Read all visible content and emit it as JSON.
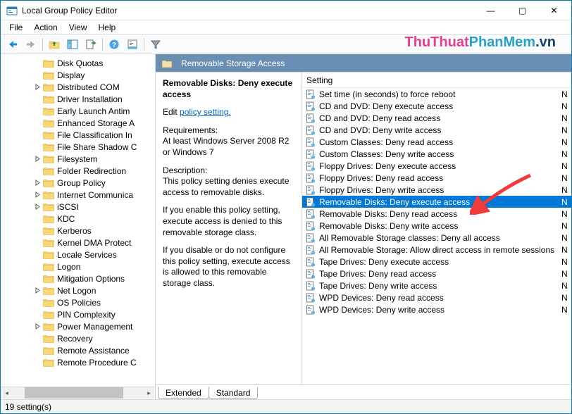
{
  "window": {
    "title": "Local Group Policy Editor",
    "minimize": "—",
    "maximize": "▢",
    "close": "✕"
  },
  "menubar": {
    "items": [
      "File",
      "Action",
      "View",
      "Help"
    ]
  },
  "tree": {
    "items": [
      {
        "label": "Disk Quotas",
        "expandable": false
      },
      {
        "label": "Display",
        "expandable": false
      },
      {
        "label": "Distributed COM",
        "expandable": true
      },
      {
        "label": "Driver Installation",
        "expandable": false
      },
      {
        "label": "Early Launch Antim",
        "expandable": false
      },
      {
        "label": "Enhanced Storage A",
        "expandable": false
      },
      {
        "label": "File Classification In",
        "expandable": false
      },
      {
        "label": "File Share Shadow C",
        "expandable": false
      },
      {
        "label": "Filesystem",
        "expandable": true
      },
      {
        "label": "Folder Redirection",
        "expandable": false
      },
      {
        "label": "Group Policy",
        "expandable": true
      },
      {
        "label": "Internet Communica",
        "expandable": true
      },
      {
        "label": "iSCSI",
        "expandable": true
      },
      {
        "label": "KDC",
        "expandable": false
      },
      {
        "label": "Kerberos",
        "expandable": false
      },
      {
        "label": "Kernel DMA Protect",
        "expandable": false
      },
      {
        "label": "Locale Services",
        "expandable": false
      },
      {
        "label": "Logon",
        "expandable": false
      },
      {
        "label": "Mitigation Options",
        "expandable": false
      },
      {
        "label": "Net Logon",
        "expandable": true
      },
      {
        "label": "OS Policies",
        "expandable": false
      },
      {
        "label": "PIN Complexity",
        "expandable": false
      },
      {
        "label": "Power Management",
        "expandable": true
      },
      {
        "label": "Recovery",
        "expandable": false
      },
      {
        "label": "Remote Assistance",
        "expandable": false
      },
      {
        "label": "Remote Procedure C",
        "expandable": false
      }
    ]
  },
  "right": {
    "header_title": "Removable Storage Access",
    "selected_title": "Removable Disks: Deny execute access",
    "edit_text": "Edit ",
    "edit_link": "policy setting.",
    "req_label": "Requirements:",
    "req_text": "At least Windows Server 2008 R2 or Windows 7",
    "desc_label": "Description:",
    "desc_text": "This policy setting denies execute access to removable disks.",
    "enable_text": "If you enable this policy setting, execute access is denied to this removable storage class.",
    "disable_text": "If you disable or do not configure this policy setting, execute access is allowed to this removable storage class.",
    "column_setting": "Setting",
    "settings": [
      {
        "label": "Set time (in seconds) to force reboot",
        "state": "N",
        "selected": false
      },
      {
        "label": "CD and DVD: Deny execute access",
        "state": "N",
        "selected": false
      },
      {
        "label": "CD and DVD: Deny read access",
        "state": "N",
        "selected": false
      },
      {
        "label": "CD and DVD: Deny write access",
        "state": "N",
        "selected": false
      },
      {
        "label": "Custom Classes: Deny read access",
        "state": "N",
        "selected": false
      },
      {
        "label": "Custom Classes: Deny write access",
        "state": "N",
        "selected": false
      },
      {
        "label": "Floppy Drives: Deny execute access",
        "state": "N",
        "selected": false
      },
      {
        "label": "Floppy Drives: Deny read access",
        "state": "N",
        "selected": false
      },
      {
        "label": "Floppy Drives: Deny write access",
        "state": "N",
        "selected": false
      },
      {
        "label": "Removable Disks: Deny execute access",
        "state": "N",
        "selected": true
      },
      {
        "label": "Removable Disks: Deny read access",
        "state": "N",
        "selected": false
      },
      {
        "label": "Removable Disks: Deny write access",
        "state": "N",
        "selected": false
      },
      {
        "label": "All Removable Storage classes: Deny all access",
        "state": "N",
        "selected": false
      },
      {
        "label": "All Removable Storage: Allow direct access in remote sessions",
        "state": "N",
        "selected": false
      },
      {
        "label": "Tape Drives: Deny execute access",
        "state": "N",
        "selected": false
      },
      {
        "label": "Tape Drives: Deny read access",
        "state": "N",
        "selected": false
      },
      {
        "label": "Tape Drives: Deny write access",
        "state": "N",
        "selected": false
      },
      {
        "label": "WPD Devices: Deny read access",
        "state": "N",
        "selected": false
      },
      {
        "label": "WPD Devices: Deny write access",
        "state": "N",
        "selected": false
      }
    ],
    "tabs": [
      "Extended",
      "Standard"
    ],
    "active_tab": 0
  },
  "statusbar": {
    "text": "19 setting(s)"
  },
  "watermark": {
    "a": "ThuThuat",
    "b": "PhanMem",
    "c": ".vn"
  }
}
